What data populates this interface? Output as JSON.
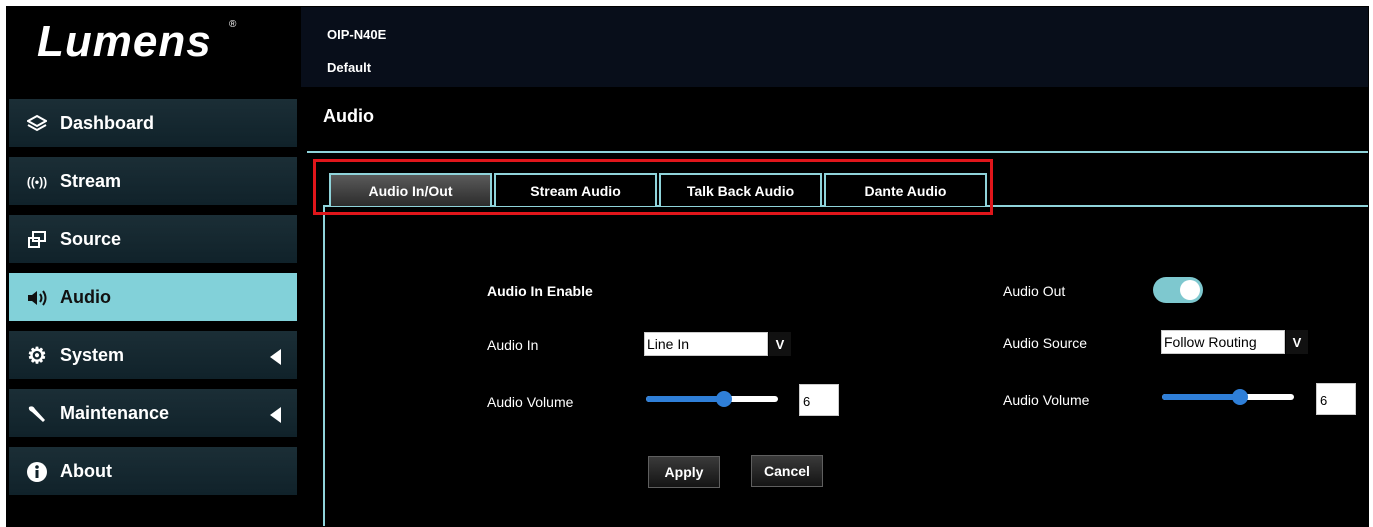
{
  "brand": {
    "logo_text": "Lumens",
    "reg_mark": "®"
  },
  "header": {
    "model": "OIP-N40E",
    "profile": "Default"
  },
  "sidebar": {
    "items": [
      {
        "label": "Dashboard",
        "icon": "layers-icon"
      },
      {
        "label": "Stream",
        "icon": "broadcast-icon"
      },
      {
        "label": "Source",
        "icon": "source-icon"
      },
      {
        "label": "Audio",
        "icon": "speaker-icon",
        "active": true
      },
      {
        "label": "System",
        "icon": "gear-icon",
        "expandable": true
      },
      {
        "label": "Maintenance",
        "icon": "wrench-icon",
        "expandable": true
      },
      {
        "label": "About",
        "icon": "info-icon"
      }
    ]
  },
  "main": {
    "title": "Audio",
    "tabs": [
      {
        "label": "Audio In/Out",
        "active": true
      },
      {
        "label": "Stream Audio"
      },
      {
        "label": "Talk Back Audio"
      },
      {
        "label": "Dante Audio"
      }
    ],
    "audio_in": {
      "enable_label": "Audio In Enable",
      "input_label": "Audio In",
      "input_value": "Line In",
      "volume_label": "Audio Volume",
      "volume_value": "6"
    },
    "audio_out": {
      "enable_label": "Audio Out",
      "enabled": true,
      "source_label": "Audio Source",
      "source_value": "Follow Routing",
      "volume_label": "Audio Volume",
      "volume_value": "6"
    },
    "buttons": {
      "apply": "Apply",
      "cancel": "Cancel"
    },
    "select_arrow": "V"
  },
  "colors": {
    "accent": "#82d1d9",
    "highlight_box": "#e0161b",
    "slider": "#2f7fd8"
  }
}
